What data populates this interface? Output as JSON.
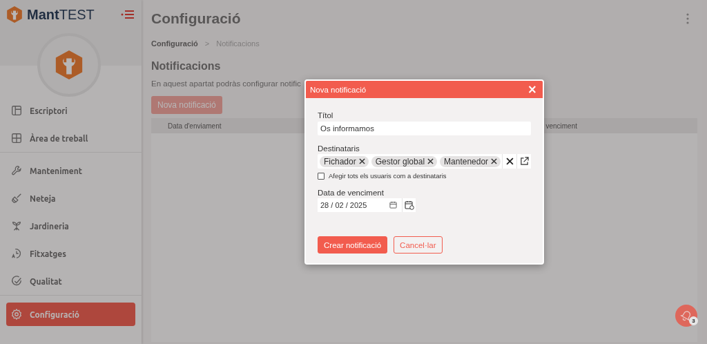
{
  "sidebar": {
    "logo_text": "**Mant**TEST",
    "groups": [
      [
        {
          "label": "Escriptori",
          "selected": false
        },
        {
          "label": "Àrea de treball",
          "selected": false
        }
      ],
      [
        {
          "label": "Manteniment",
          "selected": false
        },
        {
          "label": "Neteja",
          "selected": false
        },
        {
          "label": "Jardineria",
          "selected": false
        },
        {
          "label": "Fitxatges",
          "selected": false
        },
        {
          "label": "Qualitat",
          "selected": false
        }
      ],
      [
        {
          "label": "Configuració",
          "selected": true
        }
      ]
    ]
  },
  "page": {
    "title": "Configuració",
    "breadcrumb": [
      "Configuració",
      ">",
      "Notificacions"
    ],
    "heading": "Notificacions",
    "description": "En aquest apartat podràs configurar notific",
    "new_button": "Nova notificació",
    "table": {
      "columns": [
        "Data d'enviament",
        "venciment"
      ]
    }
  },
  "modal": {
    "title": "Nova notificació",
    "close": "×",
    "title_field": {
      "label": "Títol",
      "value": "Os informamos"
    },
    "recipients": {
      "label": "Destinataris",
      "tags": [
        "Fichador",
        "Gestor global",
        "Mantenedor"
      ]
    },
    "all_users": {
      "label": "Afegir tots els usuaris com a destinataris",
      "checked": false
    },
    "due_date": {
      "label": "Data de venciment",
      "value": "28 / 02 / 2025"
    },
    "buttons": [
      {
        "label": "Crear notificació",
        "kind": "primary"
      },
      {
        "label": "Cancel·lar",
        "kind": "secondary"
      }
    ]
  },
  "notifications": {
    "badge": "3"
  }
}
